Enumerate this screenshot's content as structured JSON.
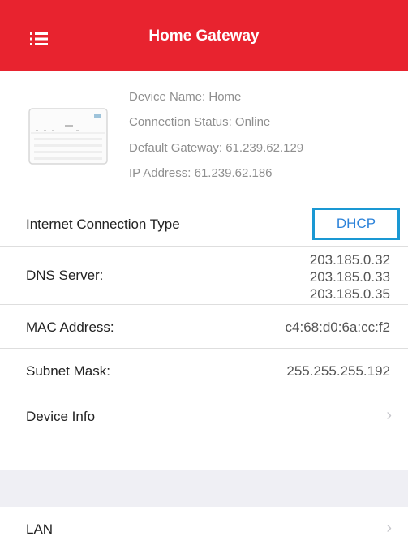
{
  "header": {
    "title": "Home Gateway",
    "menu_icon": "list-menu-icon",
    "background_color": "#e8232f"
  },
  "device": {
    "image_icon": "router-device-icon",
    "name_line": "Device Name: Home",
    "status_line": "Connection Status: Online",
    "gateway_line": "Default Gateway: 61.239.62.129",
    "ip_line": "IP Address: 61.239.62.186"
  },
  "rows": {
    "connection_type": {
      "label": "Internet Connection Type",
      "value": "DHCP"
    },
    "dns": {
      "label": "DNS Server:",
      "values": [
        "203.185.0.32",
        "203.185.0.33",
        "203.185.0.35"
      ]
    },
    "mac": {
      "label": "MAC Address:",
      "value": "c4:68:d0:6a:cc:f2"
    },
    "subnet": {
      "label": "Subnet Mask:",
      "value": "255.255.255.192"
    },
    "device_info": {
      "label": "Device Info",
      "icon": "chevron-right-icon"
    },
    "lan": {
      "label": "LAN",
      "icon": "chevron-right-icon"
    }
  },
  "colors": {
    "accent": "#2b82d9",
    "highlight_border": "#1a98d3",
    "section_gap": "#efeff4"
  }
}
